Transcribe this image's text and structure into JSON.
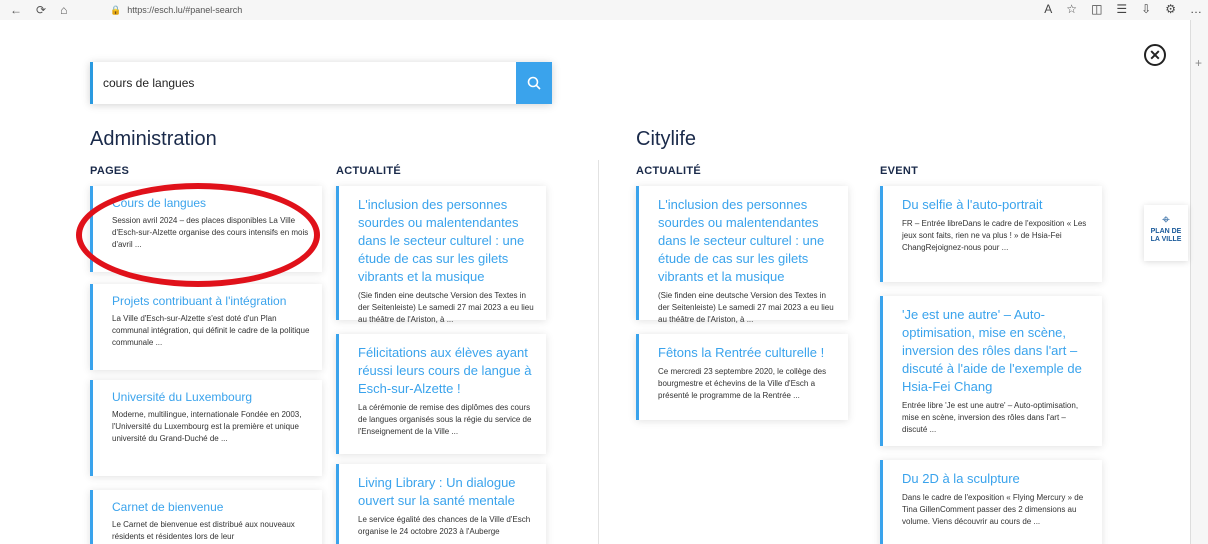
{
  "browser": {
    "url": "https://esch.lu/#panel-search"
  },
  "search": {
    "value": "cours de langues"
  },
  "map_button": {
    "line1": "PLAN DE",
    "line2": "LA VILLE"
  },
  "administration": {
    "title": "Administration",
    "pages": {
      "heading": "PAGES",
      "items": [
        {
          "title": "Cours de langues",
          "desc": "Session avril 2024 – des places disponibles La Ville d'Esch-sur-Alzette organise des cours intensifs en mois d'avril ..."
        },
        {
          "title": "Projets contribuant à l'intégration",
          "desc": "La Ville d'Esch-sur-Alzette s'est doté d'un Plan communal intégration, qui définit le cadre de la politique communale ..."
        },
        {
          "title": "Université du Luxembourg",
          "desc": "Moderne, multilingue, internationale Fondée en 2003, l'Université du Luxembourg est la première et unique université du Grand-Duché de ..."
        },
        {
          "title": "Carnet de bienvenue",
          "desc": "Le Carnet de bienvenue est distribué aux nouveaux résidents et résidentes lors de leur"
        }
      ]
    },
    "actualite": {
      "heading": "ACTUALITÉ",
      "items": [
        {
          "title": "L'inclusion des personnes sourdes ou malentendantes dans le secteur culturel : une étude de cas sur les gilets vibrants et la musique",
          "desc": "(Sie finden eine deutsche Version des Textes in der Seitenleiste) Le samedi 27 mai 2023 a eu lieu au théâtre de l'Ariston, à ..."
        },
        {
          "title": "Félicitations aux élèves ayant réussi leurs cours de langue à Esch-sur-Alzette !",
          "desc": "La cérémonie de remise des diplômes des cours de langues organisés sous la régie du service de l'Enseignement de la Ville ..."
        },
        {
          "title": "Living Library : Un dialogue ouvert sur la santé mentale",
          "desc": "Le service égalité des chances de la Ville d'Esch organise le 24 octobre 2023 à l'Auberge"
        }
      ]
    }
  },
  "citylife": {
    "title": "Citylife",
    "actualite": {
      "heading": "ACTUALITÉ",
      "items": [
        {
          "title": "L'inclusion des personnes sourdes ou malentendantes dans le secteur culturel : une étude de cas sur les gilets vibrants et la musique",
          "desc": "(Sie finden eine deutsche Version des Textes in der Seitenleiste) Le samedi 27 mai 2023 a eu lieu au théâtre de l'Ariston, à ..."
        },
        {
          "title": "Fêtons la Rentrée culturelle !",
          "desc": "Ce mercredi 23 septembre 2020, le collège des bourgmestre et échevins de la Ville d'Esch a présenté le programme de la Rentrée ..."
        }
      ]
    },
    "event": {
      "heading": "EVENT",
      "items": [
        {
          "title": "Du selfie à l'auto-portrait",
          "desc": "FR – Entrée libreDans le cadre de l'exposition « Les jeux sont faits, rien ne va plus ! » de Hsia-Fei ChangRejoignez-nous pour ..."
        },
        {
          "title": "'Je est une autre' – Auto-optimisation, mise en scène, inversion des rôles dans l'art – discuté à l'aide de l'exemple de Hsia-Fei Chang",
          "desc": "Entrée libre 'Je est une autre' – Auto-optimisation, mise en scène, inversion des rôles dans l'art – discuté ..."
        },
        {
          "title": "Du 2D à la sculpture",
          "desc": "Dans le cadre de l'exposition « Flying Mercury » de Tina GillenComment passer des 2 dimensions au volume. Viens découvrir au cours de ..."
        }
      ]
    }
  },
  "colors": {
    "accent": "#3aa3ec",
    "heading": "#1a2a4a",
    "highlight_ring": "#e0111a"
  }
}
